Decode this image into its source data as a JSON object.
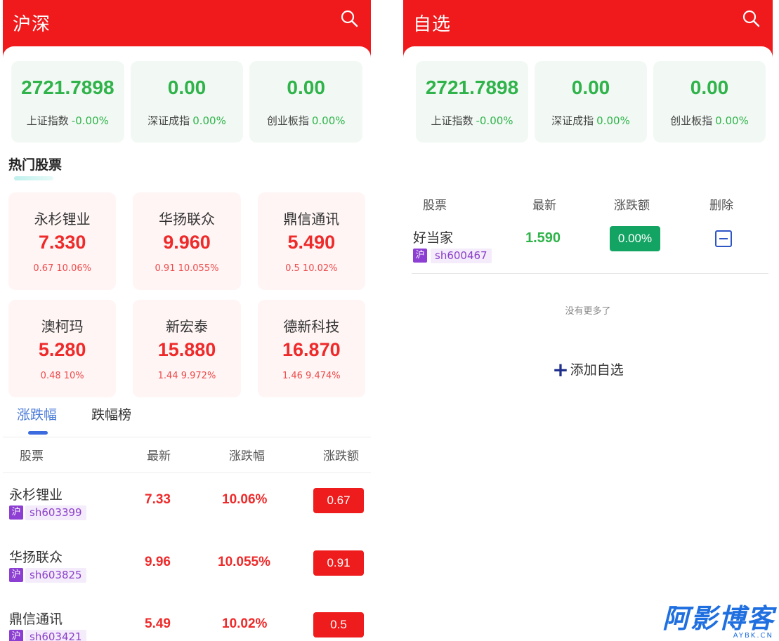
{
  "left": {
    "title": "沪深",
    "indices": [
      {
        "value": "2721.7898",
        "name": "上证指数",
        "pct": "-0.00%"
      },
      {
        "value": "0.00",
        "name": "深证成指",
        "pct": "0.00%"
      },
      {
        "value": "0.00",
        "name": "创业板指",
        "pct": "0.00%"
      }
    ],
    "hot_title": "热门股票",
    "hot": [
      {
        "name": "永杉锂业",
        "price": "7.330",
        "chg": "0.67 10.06%"
      },
      {
        "name": "华扬联众",
        "price": "9.960",
        "chg": "0.91 10.055%"
      },
      {
        "name": "鼎信通讯",
        "price": "5.490",
        "chg": "0.5 10.02%"
      },
      {
        "name": "澳柯玛",
        "price": "5.280",
        "chg": "0.48 10%"
      },
      {
        "name": "新宏泰",
        "price": "15.880",
        "chg": "1.44 9.972%"
      },
      {
        "name": "德新科技",
        "price": "16.870",
        "chg": "1.46 9.474%"
      }
    ],
    "tabs": {
      "rise": "涨跌幅",
      "fall": "跌幅榜"
    },
    "columns": {
      "stock": "股票",
      "latest": "最新",
      "pct": "涨跌幅",
      "amt": "涨跌额"
    },
    "rows": [
      {
        "name": "永杉锂业",
        "market": "沪",
        "code": "sh603399",
        "latest": "7.33",
        "pct": "10.06%",
        "amt": "0.67"
      },
      {
        "name": "华扬联众",
        "market": "沪",
        "code": "sh603825",
        "latest": "9.96",
        "pct": "10.055%",
        "amt": "0.91"
      },
      {
        "name": "鼎信通讯",
        "market": "沪",
        "code": "sh603421",
        "latest": "5.49",
        "pct": "10.02%",
        "amt": "0.5"
      }
    ]
  },
  "right": {
    "title": "自选",
    "indices": [
      {
        "value": "2721.7898",
        "name": "上证指数",
        "pct": "-0.00%"
      },
      {
        "value": "0.00",
        "name": "深证成指",
        "pct": "0.00%"
      },
      {
        "value": "0.00",
        "name": "创业板指",
        "pct": "0.00%"
      }
    ],
    "columns": {
      "stock": "股票",
      "latest": "最新",
      "amt": "涨跌额",
      "delete": "删除"
    },
    "rows": [
      {
        "name": "好当家",
        "market": "沪",
        "code": "sh600467",
        "latest": "1.590",
        "pct": "0.00%"
      }
    ],
    "no_more": "没有更多了",
    "add_label": "添加自选"
  },
  "watermark": {
    "main": "阿影博客",
    "sub": "AYBK.CN"
  },
  "colors": {
    "header_red": "#f0191b",
    "up_red": "#ee2a2a",
    "down_green": "#2fb34a",
    "accent_blue": "#3c6bdf",
    "market_purple": "#8e3fd3"
  }
}
